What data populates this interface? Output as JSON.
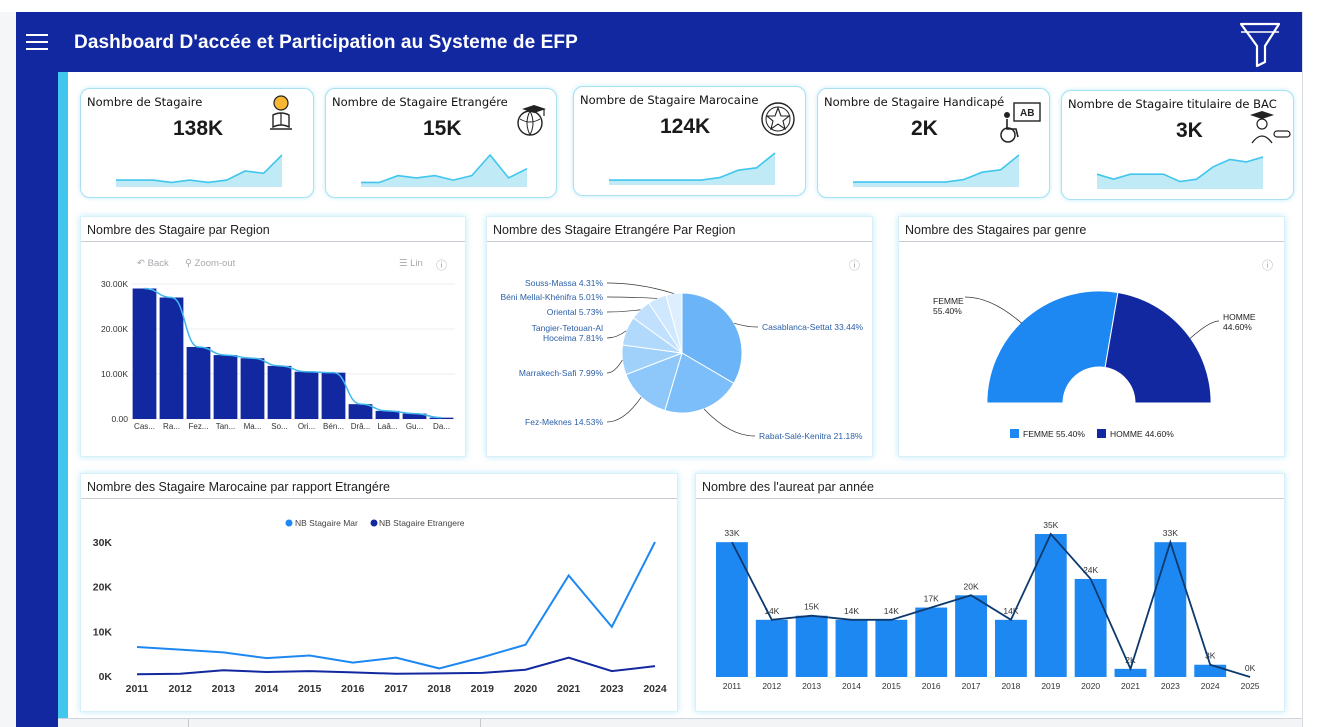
{
  "header": {
    "title": "Dashboard D'accée et Participation au Systeme de EFP"
  },
  "nav": {
    "menu_icon": "hamburger-menu-icon",
    "filter_icon": "funnel-filter-icon"
  },
  "kpis": [
    {
      "label": "Nombre de Stagaire",
      "value": "138K",
      "icon": "student-reading-icon",
      "trend": [
        3,
        3,
        3,
        2,
        3,
        2,
        3,
        7,
        6,
        14
      ]
    },
    {
      "label": "Nombre de Stagaire Etrangére",
      "value": "15K",
      "icon": "graduate-globe-icon",
      "trend": [
        2,
        2,
        5,
        4,
        5,
        3,
        5,
        14,
        4,
        8
      ]
    },
    {
      "label": "Nombre de Stagaire Marocaine",
      "value": "124K",
      "icon": "moroccan-emblem-icon",
      "trend": [
        2,
        2,
        2,
        2,
        2,
        2,
        3,
        6,
        7,
        13
      ]
    },
    {
      "label": "Nombre de Stagaire Handicapé",
      "value": "2K",
      "icon": "wheelchair-classroom-icon",
      "trend": [
        2,
        2,
        2,
        2,
        2,
        2,
        3,
        6,
        7,
        13
      ]
    },
    {
      "label": "Nombre de Stagaire titulaire de BAC",
      "value": "3K",
      "icon": "graduate-diploma-icon",
      "trend": [
        6,
        4,
        6,
        6,
        6,
        3,
        4,
        9,
        12,
        11,
        13
      ]
    }
  ],
  "region_chart": {
    "title": "Nombre des Stagaire par Region",
    "toolbar": {
      "back": "Back",
      "zoom_out": "Zoom-out",
      "lin": "Lin"
    },
    "colors": {
      "bar": "#1228a0",
      "line": "#41b8ee"
    }
  },
  "foreign_chart": {
    "title": "Nombre des Stagaire Etrangére Par Region",
    "label_color": "#2b5fa8"
  },
  "gender_chart": {
    "title": "Nombre des Stagaires par genre",
    "femme_color": "#1e88f2",
    "homme_color": "#1228a0"
  },
  "nationality_chart": {
    "title": "Nombre des Stagaire Marocaine par rapport Etrangére",
    "colors": {
      "mar": "#1e88f2",
      "etr": "#1228a0"
    }
  },
  "laureat_chart": {
    "title": "Nombre des l'aureat par année",
    "colors": {
      "bar": "#1e88f2",
      "line": "#0c3a6e"
    }
  },
  "chart_data": [
    {
      "type": "bar",
      "title": "Nombre des Stagaire par Region",
      "categories": [
        "Cas...",
        "Ra...",
        "Fez...",
        "Tan...",
        "Ma...",
        "So...",
        "Ori...",
        "Bén...",
        "Drâ...",
        "Laâ...",
        "Gu...",
        "Da..."
      ],
      "values": [
        29000,
        27000,
        16000,
        14200,
        13500,
        11800,
        10500,
        10300,
        3300,
        1800,
        1200,
        300
      ],
      "series_line": [
        29000,
        27000,
        16000,
        14200,
        13500,
        11800,
        10500,
        10300,
        3300,
        1800,
        1200,
        300
      ],
      "yticks": [
        "0.00",
        "10.00K",
        "20.00K",
        "30.00K"
      ],
      "ylim": [
        0,
        30000
      ]
    },
    {
      "type": "pie",
      "title": "Nombre des Stagaire Etrangére Par Region",
      "slices": [
        {
          "label": "Casablanca-Settat 33.44%",
          "value": 33.44
        },
        {
          "label": "Rabat-Salé-Kenitra 21.18%",
          "value": 21.18
        },
        {
          "label": "Fez-Meknes 14.53%",
          "value": 14.53
        },
        {
          "label": "Marrakech-Safi 7.99%",
          "value": 7.99
        },
        {
          "label": "Tangier-Tetouan-Al Hoceima 7.81%",
          "label_lines": [
            "Tangier-Tetouan-Al",
            "Hoceima 7.81%"
          ],
          "value": 7.81
        },
        {
          "label": "Oriental 5.73%",
          "value": 5.73
        },
        {
          "label": "Béni Mellal-Khénifra 5.01%",
          "value": 5.01
        },
        {
          "label": "Souss-Massa 4.31%",
          "value": 4.31
        }
      ]
    },
    {
      "type": "pie",
      "title": "Nombre des Stagaires par genre",
      "slices": [
        {
          "name": "FEMME",
          "pct": "55.40%",
          "value": 55.4
        },
        {
          "name": "HOMME",
          "pct": "44.60%",
          "value": 44.6
        }
      ],
      "legend": [
        "FEMME 55.40%",
        "HOMME 44.60%"
      ],
      "legend_position": "bottom"
    },
    {
      "type": "line",
      "title": "Nombre des Stagaire Marocaine par rapport Etrangére",
      "x": [
        "2011",
        "2012",
        "2013",
        "2014",
        "2015",
        "2016",
        "2017",
        "2018",
        "2019",
        "2020",
        "2021",
        "2023",
        "2024"
      ],
      "series": [
        {
          "name": "NB Stagaire Mar",
          "values": [
            6500,
            5900,
            5300,
            4000,
            4600,
            3000,
            4100,
            1700,
            4200,
            7000,
            22500,
            11000,
            30000
          ]
        },
        {
          "name": "NB Stagaire Etrangere",
          "values": [
            400,
            500,
            1300,
            900,
            1100,
            800,
            500,
            600,
            700,
            1400,
            4100,
            1100,
            2200
          ]
        }
      ],
      "yticks": [
        "0K",
        "10K",
        "20K",
        "30K"
      ],
      "ylim": [
        0,
        33000
      ],
      "legend_position": "top"
    },
    {
      "type": "bar",
      "title": "Nombre des l'aureat par année",
      "categories": [
        "2011",
        "2012",
        "2013",
        "2014",
        "2015",
        "2016",
        "2017",
        "2018",
        "2019",
        "2020",
        "2021",
        "2023",
        "2024",
        "2025"
      ],
      "values": [
        33000,
        14000,
        15000,
        14000,
        14000,
        17000,
        20000,
        14000,
        35000,
        24000,
        2000,
        33000,
        3000,
        0
      ],
      "labels": [
        "33K",
        "14K",
        "15K",
        "14K",
        "14K",
        "17K",
        "20K",
        "14K",
        "35K",
        "24K",
        "2K",
        "33K",
        "3K",
        "0K"
      ],
      "ylim": [
        0,
        38000
      ]
    }
  ]
}
